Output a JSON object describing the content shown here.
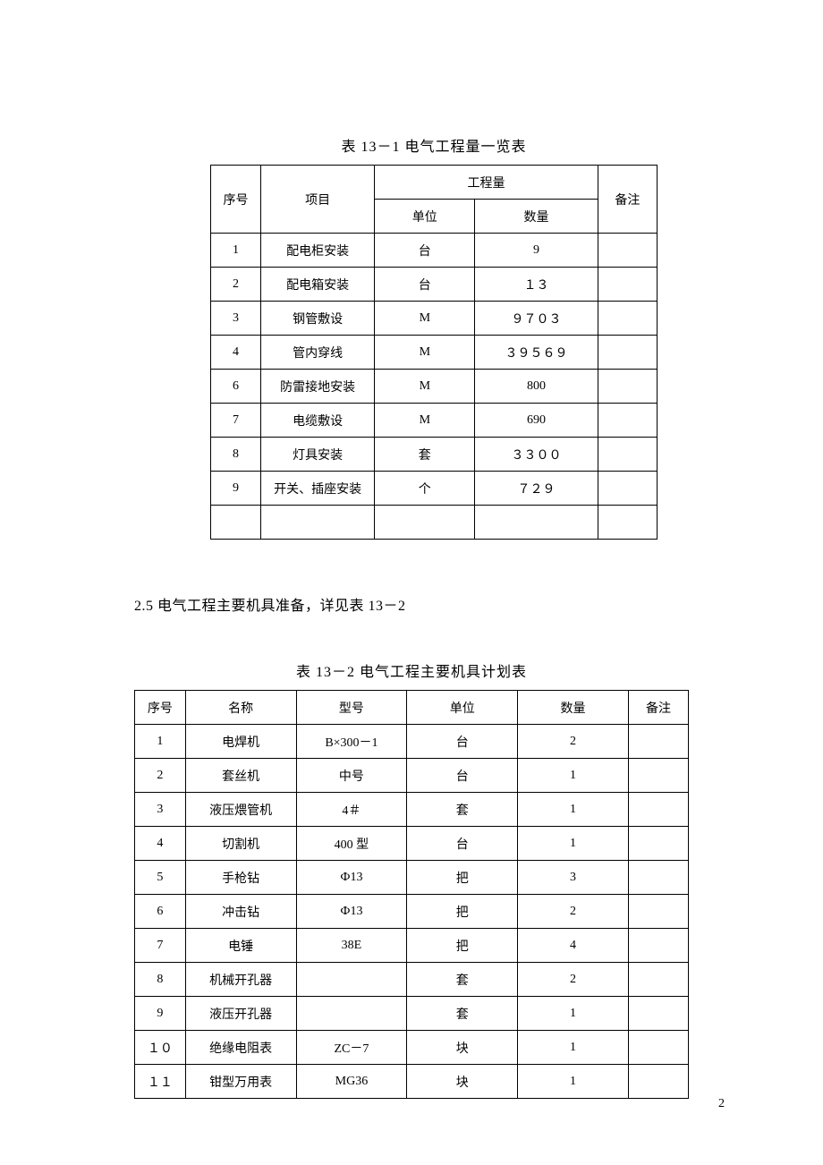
{
  "table1": {
    "title": "表 13－1 电气工程量一览表",
    "headers": {
      "seq": "序号",
      "item": "项目",
      "eng_qty": "工程量",
      "unit": "单位",
      "qty": "数量",
      "note": "备注"
    },
    "rows": [
      {
        "seq": "1",
        "item": "配电柜安装",
        "unit": "台",
        "qty": "9",
        "note": ""
      },
      {
        "seq": "2",
        "item": "配电箱安装",
        "unit": "台",
        "qty": "１３",
        "note": ""
      },
      {
        "seq": "3",
        "item": "钢管敷设",
        "unit": "M",
        "qty": "９７０３",
        "note": ""
      },
      {
        "seq": "4",
        "item": "管内穿线",
        "unit": "M",
        "qty": "３９５６９",
        "note": ""
      },
      {
        "seq": "6",
        "item": "防雷接地安装",
        "unit": "M",
        "qty": "800",
        "note": ""
      },
      {
        "seq": "7",
        "item": "电缆敷设",
        "unit": "M",
        "qty": "690",
        "note": ""
      },
      {
        "seq": "8",
        "item": "灯具安装",
        "unit": "套",
        "qty": "３３００",
        "note": ""
      },
      {
        "seq": "9",
        "item": "开关、插座安装",
        "unit": "个",
        "qty": "７２９",
        "note": ""
      },
      {
        "seq": "",
        "item": "",
        "unit": "",
        "qty": "",
        "note": ""
      }
    ]
  },
  "section_text": "2.5 电气工程主要机具准备，详见表 13－2",
  "table2": {
    "title": "表 13－2 电气工程主要机具计划表",
    "headers": {
      "seq": "序号",
      "name": "名称",
      "model": "型号",
      "unit": "单位",
      "qty": "数量",
      "note": "备注"
    },
    "rows": [
      {
        "seq": "1",
        "name": "电焊机",
        "model": "B×300－1",
        "unit": "台",
        "qty": "2",
        "note": ""
      },
      {
        "seq": "2",
        "name": "套丝机",
        "model": "中号",
        "unit": "台",
        "qty": "1",
        "note": ""
      },
      {
        "seq": "3",
        "name": "液压煨管机",
        "model": "4＃",
        "unit": "套",
        "qty": "1",
        "note": ""
      },
      {
        "seq": "4",
        "name": "切割机",
        "model": "400 型",
        "unit": "台",
        "qty": "1",
        "note": ""
      },
      {
        "seq": "5",
        "name": "手枪钻",
        "model": "Ф13",
        "unit": "把",
        "qty": "3",
        "note": ""
      },
      {
        "seq": "6",
        "name": "冲击钻",
        "model": "Ф13",
        "unit": "把",
        "qty": "2",
        "note": ""
      },
      {
        "seq": "7",
        "name": "电锤",
        "model": "38E",
        "unit": "把",
        "qty": "4",
        "note": ""
      },
      {
        "seq": "8",
        "name": "机械开孔器",
        "model": "",
        "unit": "套",
        "qty": "2",
        "note": ""
      },
      {
        "seq": "9",
        "name": "液压开孔器",
        "model": "",
        "unit": "套",
        "qty": "1",
        "note": ""
      },
      {
        "seq": "１０",
        "name": "绝缘电阻表",
        "model": "ZC－7",
        "unit": "块",
        "qty": "1",
        "note": ""
      },
      {
        "seq": "１１",
        "name": "钳型万用表",
        "model": "MG36",
        "unit": "块",
        "qty": "1",
        "note": ""
      }
    ]
  },
  "page_number": "2"
}
